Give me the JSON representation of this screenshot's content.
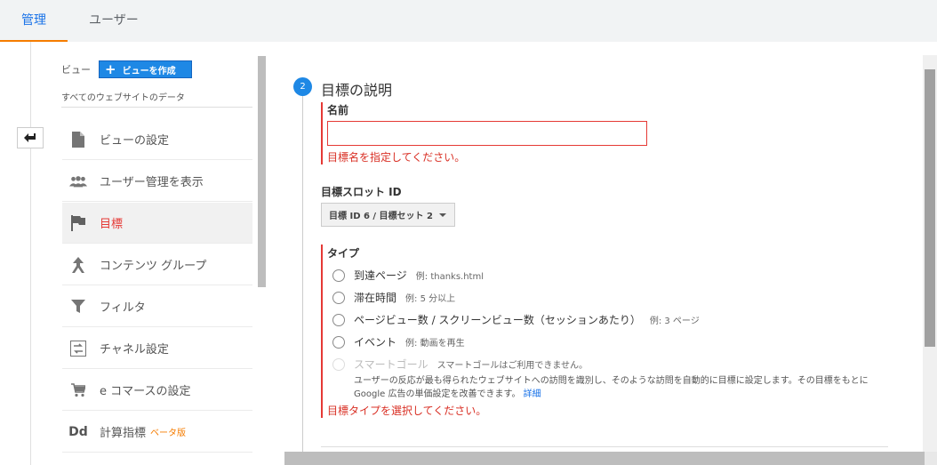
{
  "top_tabs": {
    "admin": "管理",
    "user": "ユーザー"
  },
  "sidebar": {
    "view_label": "ビュー",
    "create_view_button": "ビューを作成",
    "view_name": "すべてのウェブサイトのデータ",
    "items": [
      {
        "label": "ビューの設定",
        "icon": "document-icon"
      },
      {
        "label": "ユーザー管理を表示",
        "icon": "people-icon"
      },
      {
        "label": "目標",
        "icon": "flag-icon",
        "active": true
      },
      {
        "label": "コンテンツ グループ",
        "icon": "content-group-icon"
      },
      {
        "label": "フィルタ",
        "icon": "filter-icon"
      },
      {
        "label": "チャネル設定",
        "icon": "channel-icon"
      },
      {
        "label": "e コマースの設定",
        "icon": "cart-icon"
      },
      {
        "label": "計算指標",
        "icon": "dd-icon",
        "badge": "ベータ版"
      }
    ]
  },
  "goal_form": {
    "step_number": "2",
    "step_title": "目標の説明",
    "name_label": "名前",
    "name_value": "",
    "name_error": "目標名を指定してください。",
    "slot_label": "目標スロット ID",
    "slot_value": "目標 ID 6 / 目標セット 2",
    "type_label": "タイプ",
    "types": [
      {
        "label": "到達ページ",
        "example": "例: thanks.html"
      },
      {
        "label": "滞在時間",
        "example": "例: 5 分以上"
      },
      {
        "label": "ページビュー数 / スクリーンビュー数（セッションあたり）",
        "example": "例: 3 ページ"
      },
      {
        "label": "イベント",
        "example": "例: 動画を再生"
      },
      {
        "label": "スマートゴール",
        "example": "スマートゴールはご利用できません。",
        "disabled": true
      }
    ],
    "smart_goal_desc": "ユーザーの反応が最も得られたウェブサイトへの訪問を識別し、そのような訪問を自動的に目標に設定します。その目標をもとに Google 広告の単価設定を改善できます。",
    "smart_goal_link": "詳細",
    "type_error": "目標タイプを選択してください。"
  },
  "colors": {
    "accent": "#1e88e5",
    "error": "#e53935",
    "tab_underline": "#f57c00"
  }
}
